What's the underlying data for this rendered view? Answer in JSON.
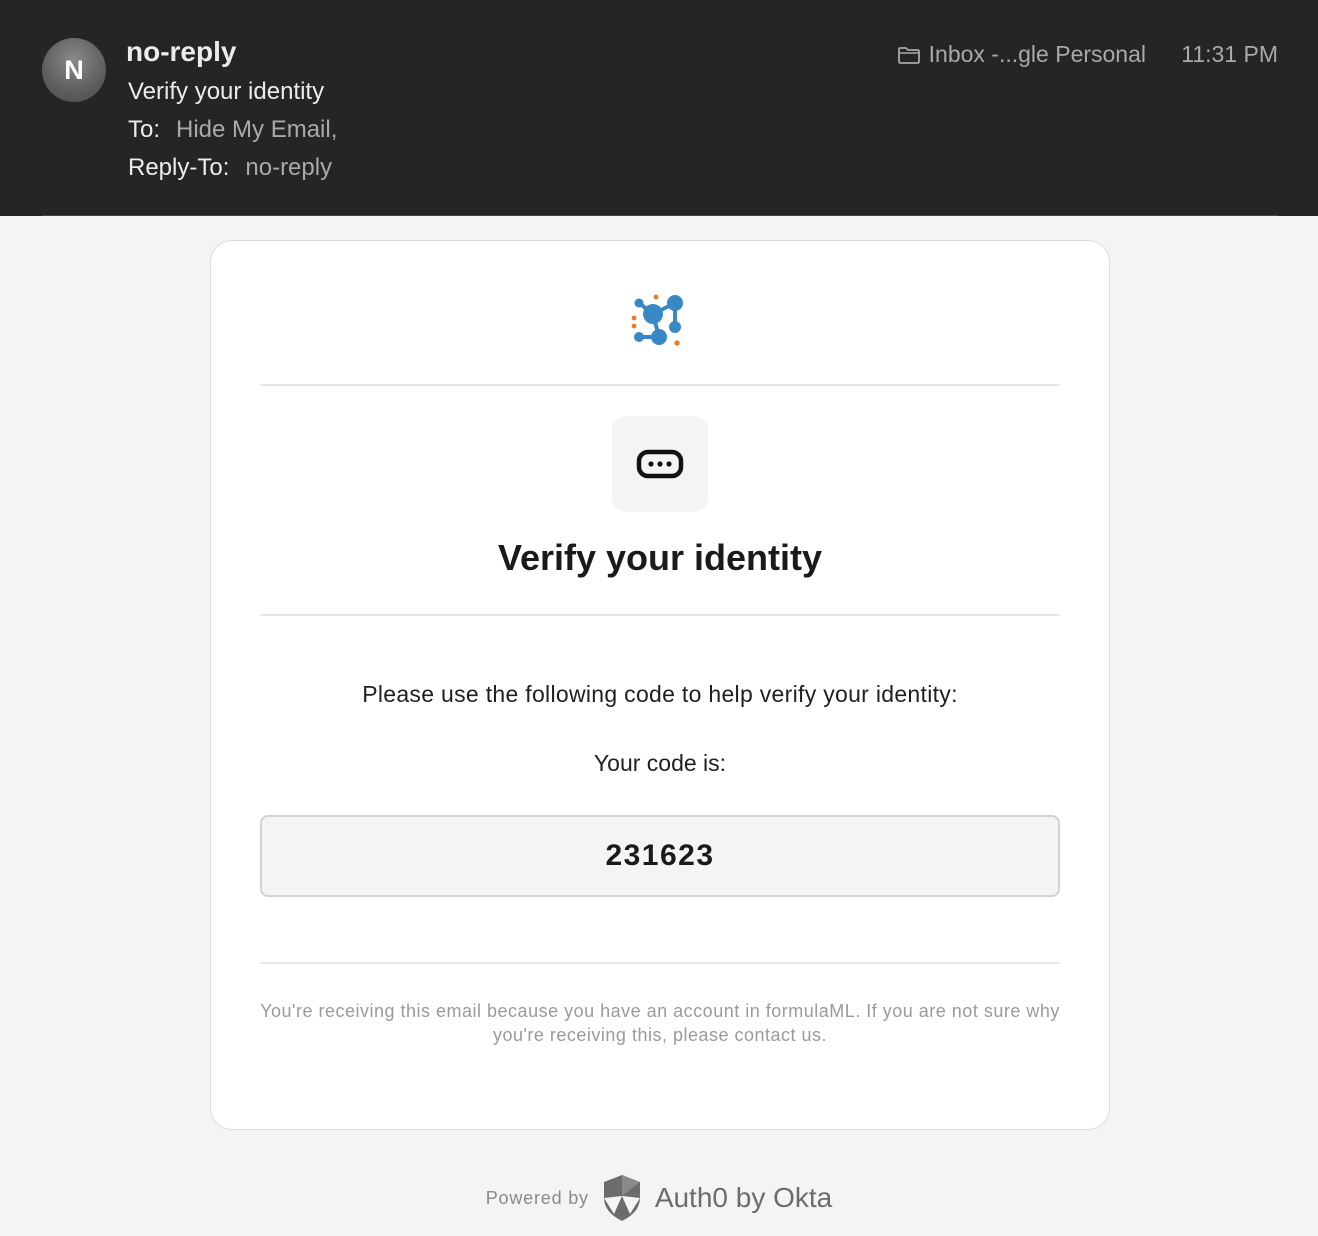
{
  "header": {
    "avatar_initial": "N",
    "sender": "no-reply",
    "subject": "Verify your identity",
    "to_label": "To:",
    "to_value": "Hide My Email,",
    "reply_to_label": "Reply-To:",
    "reply_to_value": "no-reply",
    "mailbox": "Inbox -...gle Personal",
    "time": "11:31 PM",
    "icons": {
      "mailbox": "folder-icon"
    }
  },
  "card": {
    "icons": {
      "logo": "formulaml-logo-icon",
      "otp": "otp-dots-icon"
    },
    "title": "Verify your identity",
    "instruction": "Please use the following code to help verify your identity:",
    "code_label": "Your code is:",
    "code": "231623",
    "footnote": "You're receiving this email because you have an account in formulaML. If you are not sure why you're receiving this, please contact us."
  },
  "powered": {
    "label": "Powered by",
    "brand": "Auth0 by Okta",
    "icons": {
      "brand": "auth0-shield-icon"
    }
  },
  "colors": {
    "header_bg": "#252525",
    "page_bg": "#f4f4f4",
    "logo_blue": "#3a87c5",
    "logo_orange": "#f07a1a"
  }
}
